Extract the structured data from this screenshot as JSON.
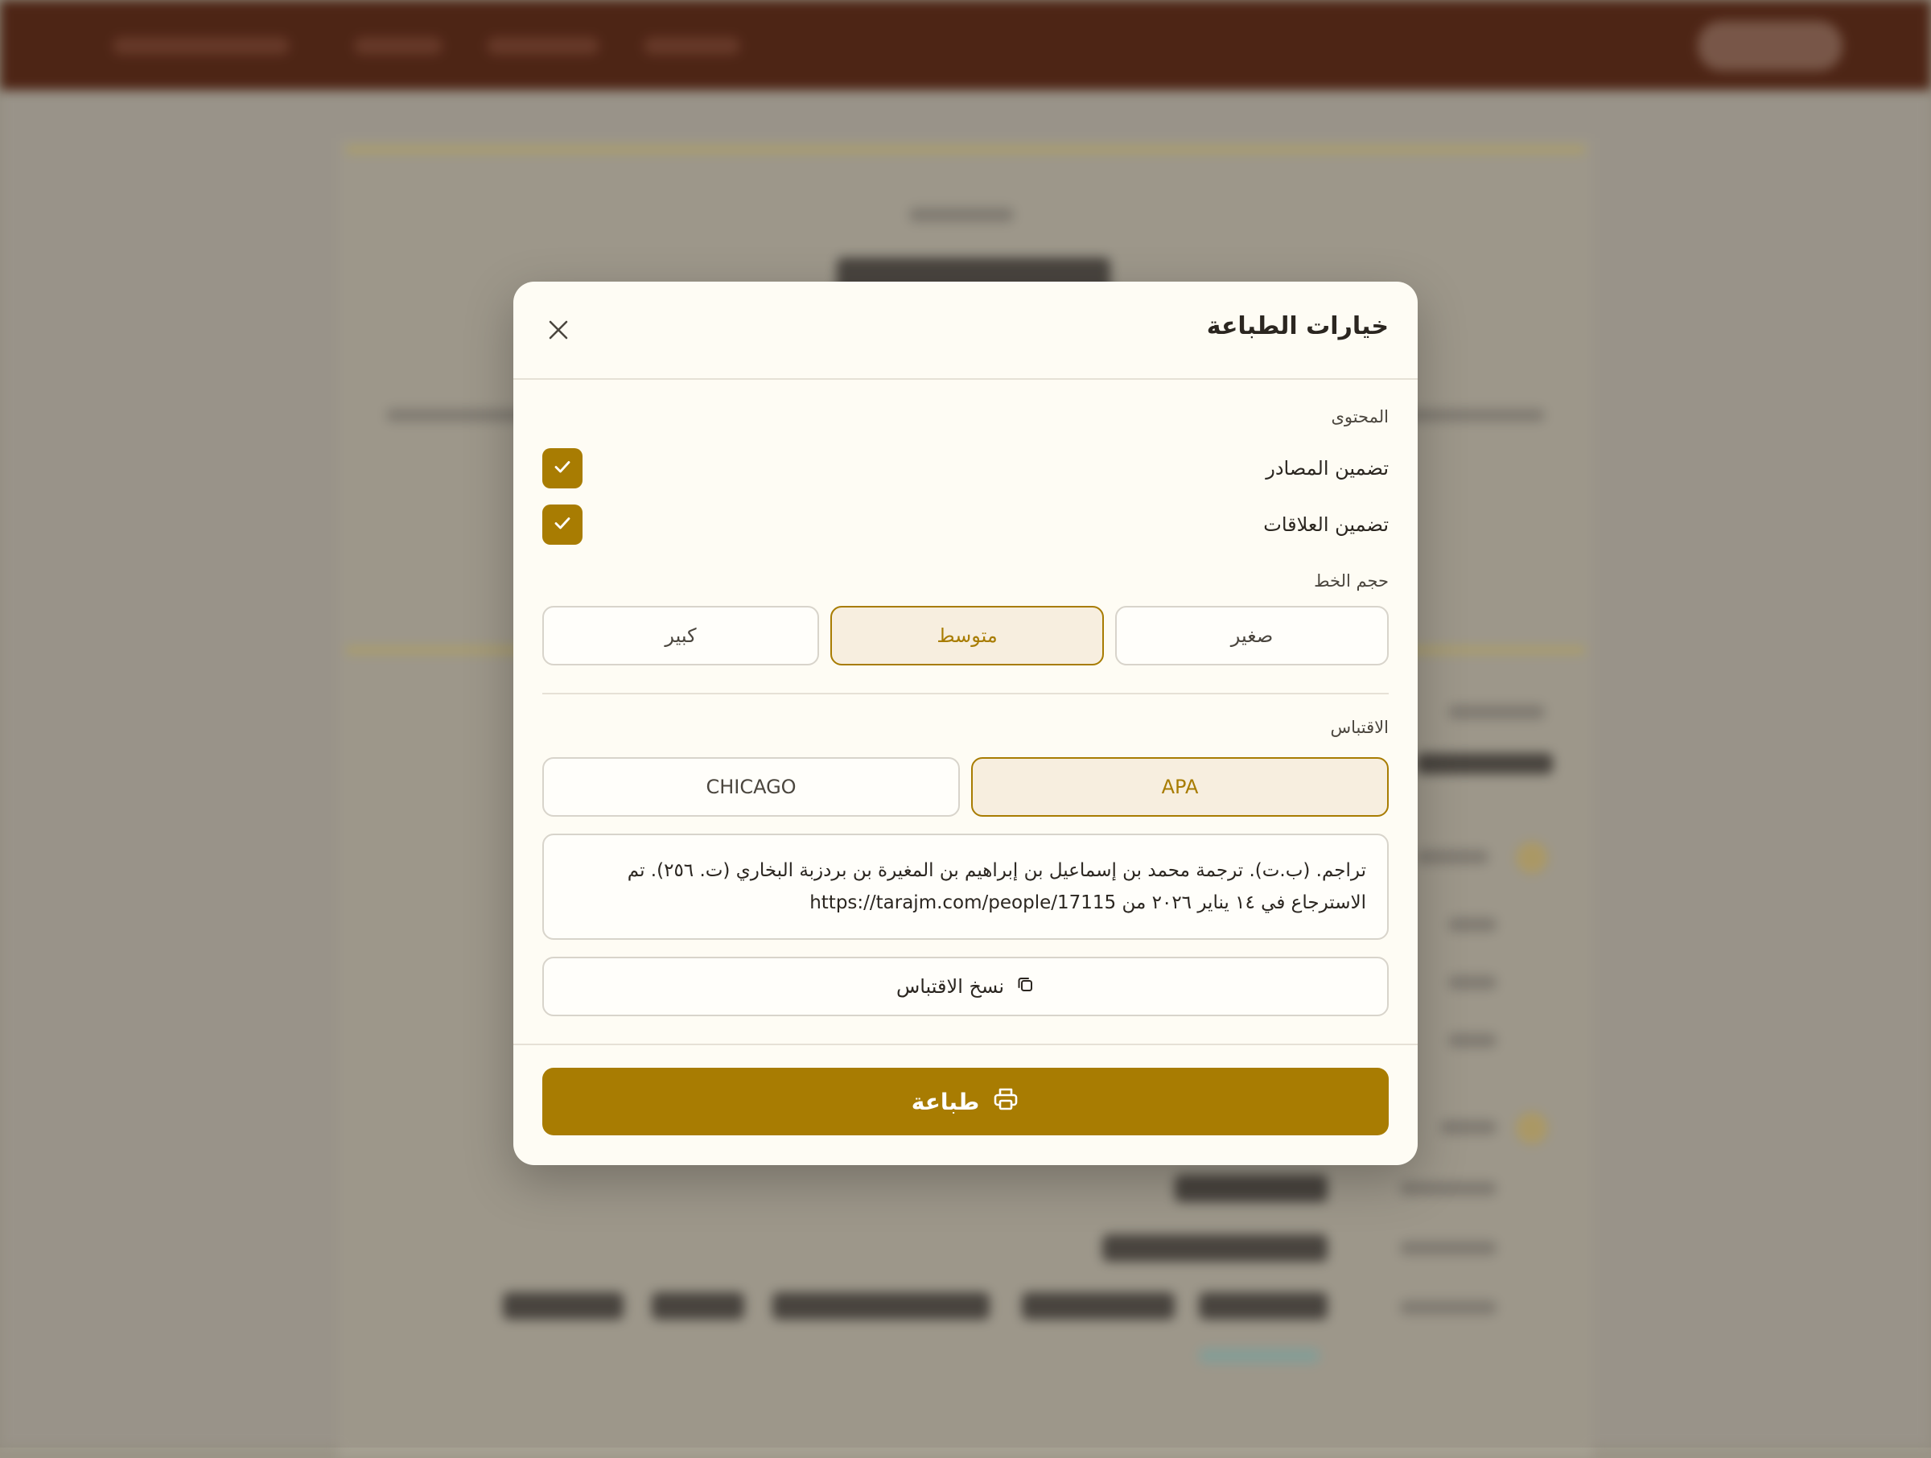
{
  "modal": {
    "title": "خيارات الطباعة",
    "content_section": {
      "label": "المحتوى",
      "options": [
        {
          "label": "تضمين المصادر",
          "checked": true
        },
        {
          "label": "تضمين العلاقات",
          "checked": true
        }
      ]
    },
    "font_size_section": {
      "label": "حجم الخط",
      "options": [
        "صغير",
        "متوسط",
        "كبير"
      ],
      "selected": "متوسط"
    },
    "citation_section": {
      "label": "الاقتباس",
      "styles": [
        "APA",
        "CHICAGO"
      ],
      "selected": "APA",
      "text": "تراجم. (ب.ت). ترجمة محمد بن إسماعيل بن إبراهيم بن المغيرة بن بردزبة البخاري (ت. ٢٥٦). تم الاسترجاع في ١٤ يناير ٢٠٢٦ من https://tarajm.com/people/17115",
      "copy_label": "نسخ الاقتباس"
    },
    "print_label": "طباعة"
  },
  "colors": {
    "accent": "#a87c02",
    "active_bg": "#f7eedf",
    "modal_bg": "#fefcf4",
    "topbar": "#4f2413"
  },
  "icons": {
    "close": "close-icon",
    "check": "check-icon",
    "copy": "copy-icon",
    "print": "printer-icon"
  }
}
